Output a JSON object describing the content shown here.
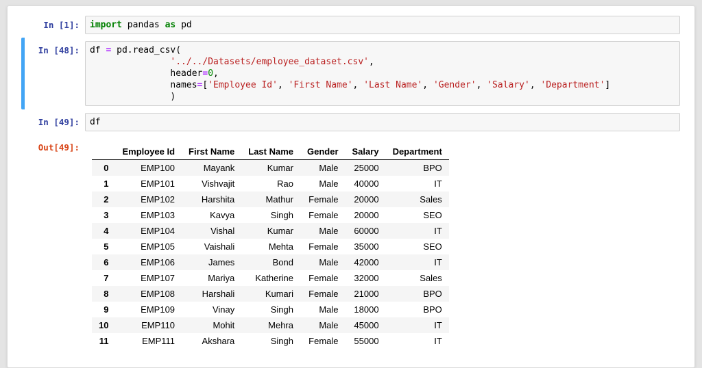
{
  "colors": {
    "in-prompt": "#303f9f",
    "out-prompt": "#d84315",
    "selection": "#42a5f5",
    "kw": "#008000",
    "str": "#ba2121",
    "num": "#008800",
    "op": "#aa22ff"
  },
  "notebook": {
    "cells": [
      {
        "prompt": "In [1]:",
        "selected": false,
        "lines": [
          [
            {
              "t": "kw",
              "s": "import"
            },
            {
              "t": "pl",
              "s": " pandas "
            },
            {
              "t": "kw",
              "s": "as"
            },
            {
              "t": "pl",
              "s": " pd"
            }
          ]
        ]
      },
      {
        "prompt": "In [48]:",
        "selected": true,
        "lines": [
          [
            {
              "t": "pl",
              "s": "df "
            },
            {
              "t": "op",
              "s": "="
            },
            {
              "t": "pl",
              "s": " pd.read_csv("
            }
          ],
          [
            {
              "t": "pl",
              "s": "               "
            },
            {
              "t": "str",
              "s": "'../../Datasets/employee_dataset.csv'"
            },
            {
              "t": "pl",
              "s": ","
            }
          ],
          [
            {
              "t": "pl",
              "s": "               header"
            },
            {
              "t": "op",
              "s": "="
            },
            {
              "t": "num",
              "s": "0"
            },
            {
              "t": "pl",
              "s": ","
            }
          ],
          [
            {
              "t": "pl",
              "s": "               names"
            },
            {
              "t": "op",
              "s": "="
            },
            {
              "t": "pl",
              "s": "["
            },
            {
              "t": "str",
              "s": "'Employee Id'"
            },
            {
              "t": "pl",
              "s": ", "
            },
            {
              "t": "str",
              "s": "'First Name'"
            },
            {
              "t": "pl",
              "s": ", "
            },
            {
              "t": "str",
              "s": "'Last Name'"
            },
            {
              "t": "pl",
              "s": ", "
            },
            {
              "t": "str",
              "s": "'Gender'"
            },
            {
              "t": "pl",
              "s": ", "
            },
            {
              "t": "str",
              "s": "'Salary'"
            },
            {
              "t": "pl",
              "s": ", "
            },
            {
              "t": "str",
              "s": "'Department'"
            },
            {
              "t": "pl",
              "s": "]"
            }
          ],
          [
            {
              "t": "pl",
              "s": "               )"
            }
          ]
        ]
      },
      {
        "prompt": "In [49]:",
        "selected": false,
        "lines": [
          [
            {
              "t": "pl",
              "s": "df"
            }
          ]
        ]
      }
    ],
    "output": {
      "prompt": "Out[49]:",
      "table": {
        "columns": [
          "",
          "Employee Id",
          "First Name",
          "Last Name",
          "Gender",
          "Salary",
          "Department"
        ],
        "rows": [
          [
            "0",
            "EMP100",
            "Mayank",
            "Kumar",
            "Male",
            "25000",
            "BPO"
          ],
          [
            "1",
            "EMP101",
            "Vishvajit",
            "Rao",
            "Male",
            "40000",
            "IT"
          ],
          [
            "2",
            "EMP102",
            "Harshita",
            "Mathur",
            "Female",
            "20000",
            "Sales"
          ],
          [
            "3",
            "EMP103",
            "Kavya",
            "Singh",
            "Female",
            "20000",
            "SEO"
          ],
          [
            "4",
            "EMP104",
            "Vishal",
            "Kumar",
            "Male",
            "60000",
            "IT"
          ],
          [
            "5",
            "EMP105",
            "Vaishali",
            "Mehta",
            "Female",
            "35000",
            "SEO"
          ],
          [
            "6",
            "EMP106",
            "James",
            "Bond",
            "Male",
            "42000",
            "IT"
          ],
          [
            "7",
            "EMP107",
            "Mariya",
            "Katherine",
            "Female",
            "32000",
            "Sales"
          ],
          [
            "8",
            "EMP108",
            "Harshali",
            "Kumari",
            "Female",
            "21000",
            "BPO"
          ],
          [
            "9",
            "EMP109",
            "Vinay",
            "Singh",
            "Male",
            "18000",
            "BPO"
          ],
          [
            "10",
            "EMP110",
            "Mohit",
            "Mehra",
            "Male",
            "45000",
            "IT"
          ],
          [
            "11",
            "EMP111",
            "Akshara",
            "Singh",
            "Female",
            "55000",
            "IT"
          ]
        ]
      }
    }
  }
}
